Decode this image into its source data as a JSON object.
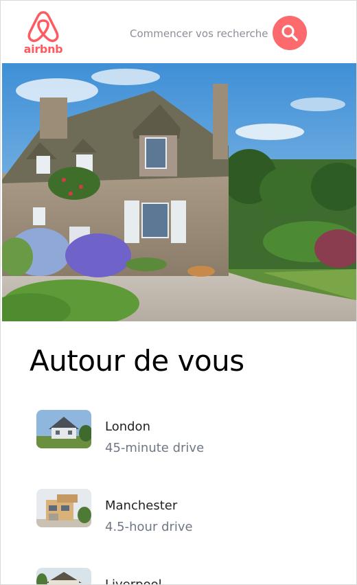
{
  "brand": {
    "name": "airbnb",
    "color": "#ff5a5f"
  },
  "search": {
    "placeholder": "Commencer vos recherche",
    "button_icon": "search-icon",
    "button_color": "#fc6a6d"
  },
  "hero": {
    "image_subject": "stone country cottage with hydrangeas"
  },
  "section": {
    "title": "Autour de vous"
  },
  "places": [
    {
      "name": "London",
      "drive": "45-minute drive"
    },
    {
      "name": "Manchester",
      "drive": "4.5-hour drive"
    },
    {
      "name": "Liverpool",
      "drive": ""
    }
  ]
}
